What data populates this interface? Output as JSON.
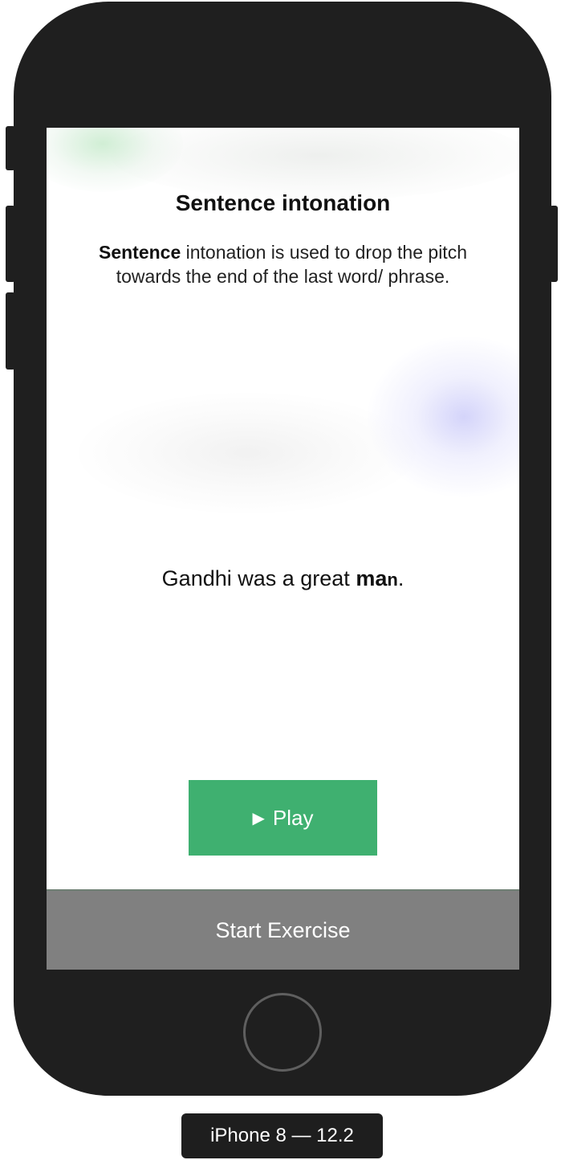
{
  "app": {
    "title": "Sentence intonation",
    "description_bold": "Sentence",
    "description_rest": " intonation is used to drop the pitch towards the end of the last word/ phrase.",
    "example_prefix": "Gandhi was a great ",
    "example_bold_1": "ma",
    "example_bold_2": "n",
    "example_suffix": ".",
    "play_icon": "▶",
    "play_label": "Play",
    "start_label": "Start Exercise"
  },
  "device": {
    "label": "iPhone 8 — 12.2"
  },
  "colors": {
    "play_button": "#3fb070",
    "start_bar": "#808080",
    "phone_body": "#1f1f1f"
  },
  "icons": {
    "play": "play-icon",
    "home": "home-button"
  }
}
